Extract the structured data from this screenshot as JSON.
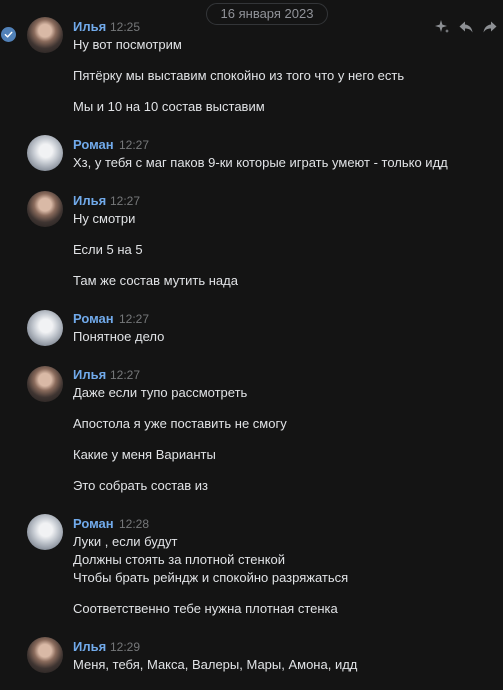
{
  "date_divider": "16 января 2023",
  "icons": {
    "selected": "check-circle-icon",
    "actions": [
      "sparkle-icon",
      "reply-icon",
      "forward-icon"
    ]
  },
  "colors": {
    "background": "#141414",
    "author": "#71aaeb",
    "text": "#e1e3e6",
    "time": "#76787a",
    "accent": "#5181b8"
  },
  "messages": [
    {
      "author": "Илья",
      "time": "12:25",
      "lines": [
        "Ну вот посмотрим",
        "Пятёрку мы выставим спокойно из того что у него есть",
        "Мы и 10 на 10 состав выставим"
      ]
    },
    {
      "author": "Роман",
      "time": "12:27",
      "lines": [
        "Хз, у тебя с маг паков 9-ки которые играть умеют - только идд"
      ]
    },
    {
      "author": "Илья",
      "time": "12:27",
      "lines": [
        "Ну смотри",
        "Если 5 на 5",
        "Там же состав мутить нада"
      ]
    },
    {
      "author": "Роман",
      "time": "12:27",
      "lines": [
        "Понятное дело"
      ]
    },
    {
      "author": "Илья",
      "time": "12:27",
      "lines": [
        "Даже если тупо рассмотреть",
        "Апостола я уже поставить не смогу",
        "Какие у меня Варианты",
        "Это собрать состав из"
      ]
    },
    {
      "author": "Роман",
      "time": "12:28",
      "lines": [
        "Луки , если будут",
        "Должны стоять за плотной стенкой",
        "Чтобы брать рейндж и спокойно разряжаться",
        "Соответственно тебе нужна плотная стенка"
      ]
    },
    {
      "author": "Илья",
      "time": "12:29",
      "lines": [
        "Меня, тебя, Макса, Валеры, Мары, Амона, идд"
      ]
    }
  ]
}
